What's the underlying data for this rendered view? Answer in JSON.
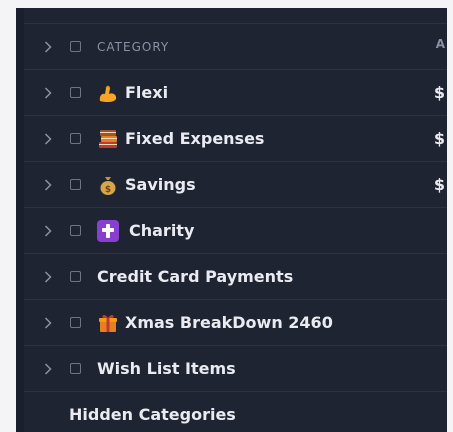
{
  "header": {
    "label": "CATEGORY",
    "amount_label": "A"
  },
  "categories": [
    {
      "label": "Flexi",
      "icon": "flexed-bicep-icon",
      "amount": "$"
    },
    {
      "label": "Fixed Expenses",
      "icon": "books-icon",
      "amount": "$"
    },
    {
      "label": "Savings",
      "icon": "money-bag-icon",
      "amount": "$"
    },
    {
      "label": "Charity",
      "icon": "latin-cross-icon",
      "amount": ""
    },
    {
      "label": "Credit Card Payments",
      "icon": "",
      "amount": ""
    },
    {
      "label": "Xmas BreakDown 2460",
      "icon": "gift-icon",
      "amount": ""
    },
    {
      "label": "Wish List Items",
      "icon": "",
      "amount": ""
    }
  ],
  "hidden": {
    "label": "Hidden Categories"
  },
  "colors": {
    "panel": "#1f2433",
    "text": "#e9ebf1",
    "muted": "#8a91a3",
    "divider": "#2c3242"
  }
}
